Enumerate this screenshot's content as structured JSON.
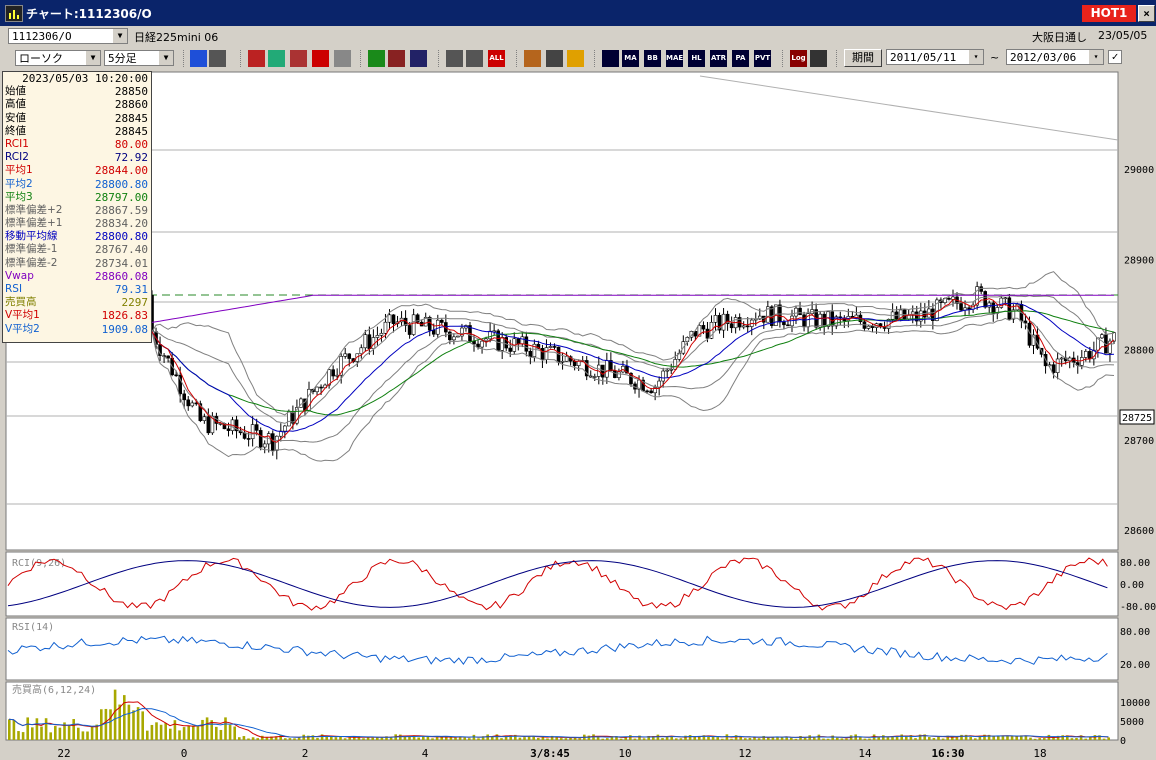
{
  "window": {
    "title": "チャート:1112306/O",
    "hot_label": "HOT1",
    "close_label": "×"
  },
  "info_row": {
    "symbol_value": "1112306/O",
    "instrument_name": "日経225mini 06",
    "session": "大阪日通し",
    "date": "23/05/05"
  },
  "toolbar": {
    "chart_type": "ローソク",
    "interval": "5分足",
    "period_label": "期間",
    "date_from": "2011/05/11",
    "date_to": "2012/03/06",
    "range_sep": "~",
    "buttons": [
      {
        "name": "zoom-icon",
        "color": "#1e4fd8"
      },
      {
        "name": "cursor-icon",
        "color": "#555"
      },
      {
        "name": "download-icon",
        "color": "#b22"
      },
      {
        "name": "settings-icon",
        "color": "#2a7"
      },
      {
        "name": "bar-chart-icon",
        "color": "#a33"
      },
      {
        "name": "plus-icon",
        "color": "#c00"
      },
      {
        "name": "info-icon",
        "color": "#888"
      },
      {
        "name": "pencil-icon",
        "color": "#1a8a1a"
      },
      {
        "name": "arrow-icon",
        "color": "#822"
      },
      {
        "name": "undo-icon",
        "color": "#226"
      },
      {
        "name": "candle-icon",
        "color": "#555"
      },
      {
        "name": "candle2-icon",
        "color": "#555"
      },
      {
        "name": "all-icon",
        "label": "ALL",
        "color": "#c00"
      },
      {
        "name": "wrench-icon",
        "color": "#b5651d"
      },
      {
        "name": "brush-icon",
        "color": "#444"
      },
      {
        "name": "palette-icon",
        "color": "#e0a000"
      },
      {
        "name": "vol-icon",
        "color": "#003"
      },
      {
        "name": "ma-icon",
        "label": "MA",
        "color": "#003"
      },
      {
        "name": "bb-icon",
        "label": "BB",
        "color": "#003"
      },
      {
        "name": "mae-icon",
        "label": "MAE",
        "color": "#003"
      },
      {
        "name": "hl-icon",
        "label": "HL",
        "color": "#003"
      },
      {
        "name": "atr-icon",
        "label": "ATR",
        "color": "#003"
      },
      {
        "name": "pa-icon",
        "label": "PA",
        "color": "#003"
      },
      {
        "name": "pvt-icon",
        "label": "PVT",
        "color": "#003"
      },
      {
        "name": "log-icon",
        "label": "Log",
        "color": "#800"
      },
      {
        "name": "window-icon",
        "color": "#333"
      }
    ]
  },
  "info_panel": {
    "datetime": "2023/05/03  10:20:00",
    "rows": [
      {
        "k": "始値",
        "v": "28850",
        "c": "#000"
      },
      {
        "k": "高値",
        "v": "28860",
        "c": "#000"
      },
      {
        "k": "安値",
        "v": "28845",
        "c": "#000"
      },
      {
        "k": "終値",
        "v": "28845",
        "c": "#000"
      },
      {
        "k": "RCI1",
        "v": "80.00",
        "c": "#d00000"
      },
      {
        "k": "RCI2",
        "v": "72.92",
        "c": "#000080"
      },
      {
        "k": "平均1",
        "v": "28844.00",
        "c": "#d00000"
      },
      {
        "k": "平均2",
        "v": "28800.80",
        "c": "#1060d0"
      },
      {
        "k": "平均3",
        "v": "28797.00",
        "c": "#108010"
      },
      {
        "k": "標準偏差+2",
        "v": "28867.59",
        "c": "#606060"
      },
      {
        "k": "標準偏差+1",
        "v": "28834.20",
        "c": "#606060"
      },
      {
        "k": "移動平均線",
        "v": "28800.80",
        "c": "#0000c0"
      },
      {
        "k": "標準偏差-1",
        "v": "28767.40",
        "c": "#606060"
      },
      {
        "k": "標準偏差-2",
        "v": "28734.01",
        "c": "#606060"
      },
      {
        "k": "Vwap",
        "v": "28860.08",
        "c": "#8000c0"
      },
      {
        "k": "RSI",
        "v": "79.31",
        "c": "#1060d0"
      },
      {
        "k": "売買高",
        "v": "2297",
        "c": "#808000"
      },
      {
        "k": "V平均1",
        "v": "1826.83",
        "c": "#d00000"
      },
      {
        "k": "V平均2",
        "v": "1909.08",
        "c": "#1060d0"
      }
    ]
  },
  "chart": {
    "price_ticks": [
      "29000",
      "28900",
      "28800",
      "28700",
      "28600"
    ],
    "price_marker": "28725",
    "x_ticks": [
      {
        "label": "22",
        "bold": false
      },
      {
        "label": "0",
        "bold": false
      },
      {
        "label": "2",
        "bold": false
      },
      {
        "label": "4",
        "bold": false
      },
      {
        "label": "3/8:45",
        "bold": true
      },
      {
        "label": "10",
        "bold": false
      },
      {
        "label": "12",
        "bold": false
      },
      {
        "label": "14",
        "bold": false
      },
      {
        "label": "16:30",
        "bold": true
      },
      {
        "label": "18",
        "bold": false
      }
    ],
    "rci_title": "RCI(9,26)",
    "rci_ticks": [
      "80.00",
      "0.00",
      "-80.00"
    ],
    "rsi_title": "RSI(14)",
    "rsi_ticks": [
      "80.00",
      "20.00"
    ],
    "vol_title": "売買高(6,12,24)",
    "vol_ticks": [
      "10000",
      "5000",
      "0"
    ],
    "colors": {
      "bull": "#ffffff",
      "bear": "#000000",
      "rci1": "#d00000",
      "rci2": "#000080",
      "rsi": "#1060d0",
      "vol": "#a8a800",
      "vwap": "#8000c0",
      "ma3": "#108010",
      "bb": "#808080"
    }
  }
}
